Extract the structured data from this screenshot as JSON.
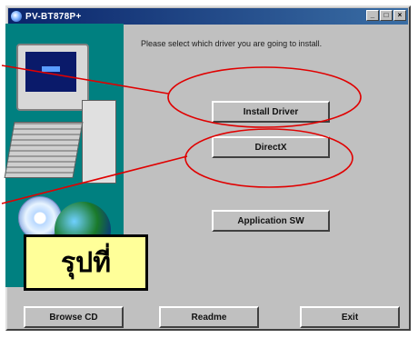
{
  "window": {
    "title": "PV-BT878P+",
    "controls": {
      "minimize": "_",
      "maximize": "□",
      "close": "×"
    }
  },
  "instruction": "Please select which driver you are going to install.",
  "buttons": {
    "install_driver": "Install Driver",
    "directx": "DirectX",
    "application_sw": "Application SW",
    "browse_cd": "Browse CD",
    "readme": "Readme",
    "exit": "Exit"
  },
  "callout_label": "รุปที่",
  "annotation_color": "#e00000",
  "icons": [
    "computer-icon",
    "cd-icon",
    "globe-icon"
  ]
}
